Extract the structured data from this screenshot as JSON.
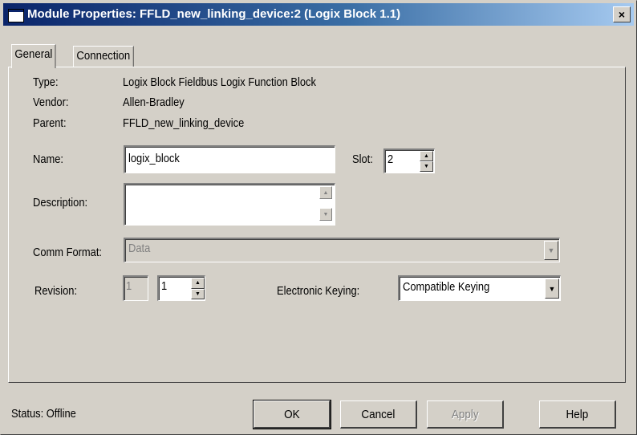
{
  "window": {
    "title": "Module Properties: FFLD_new_linking_device:2 (Logix Block 1.1)",
    "close_glyph": "×"
  },
  "tabs": [
    {
      "label": "General",
      "active": true
    },
    {
      "label": "Connection",
      "active": false
    }
  ],
  "info": {
    "type_label": "Type:",
    "type_value": "Logix Block Fieldbus Logix Function Block",
    "vendor_label": "Vendor:",
    "vendor_value": "Allen-Bradley",
    "parent_label": "Parent:",
    "parent_value": "FFLD_new_linking_device"
  },
  "form": {
    "name_label": "Name:",
    "name_value": "logix_block",
    "slot_label": "Slot:",
    "slot_value": "2",
    "description_label": "Description:",
    "description_value": "",
    "comm_format_label": "Comm Format:",
    "comm_format_value": "Data",
    "revision_label": "Revision:",
    "revision_major": "1",
    "revision_minor": "1",
    "keying_label": "Electronic Keying:",
    "keying_value": "Compatible Keying"
  },
  "footer": {
    "status": "Status:  Offline",
    "ok_label": "OK",
    "cancel_label": "Cancel",
    "apply_label": "Apply",
    "help_label": "Help"
  },
  "colors": {
    "face": "#d4d0c8",
    "title_start": "#0a246a",
    "title_end": "#a6caf0"
  },
  "icons": {
    "up": "▲",
    "down": "▼"
  }
}
